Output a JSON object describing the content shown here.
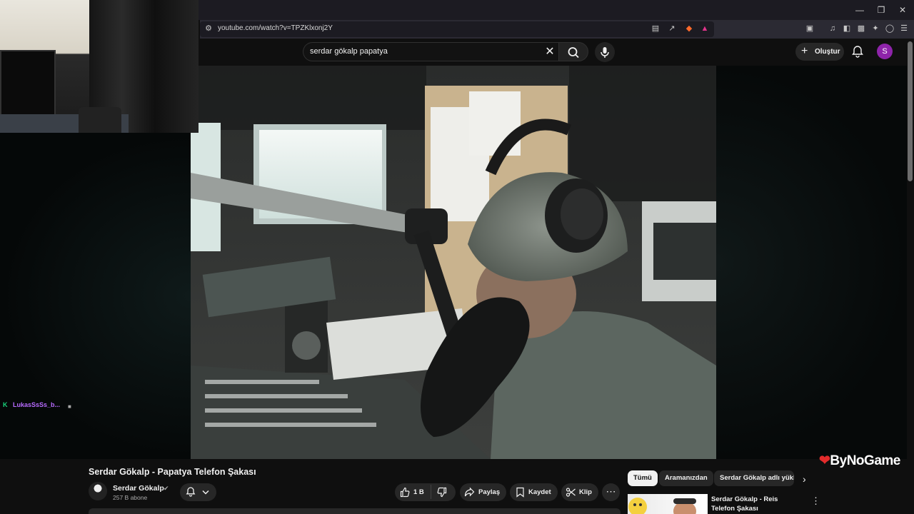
{
  "browser": {
    "url": "youtube.com/watch?v=TPZKlxonj2Y",
    "window_controls": [
      "minimize",
      "restore",
      "close"
    ]
  },
  "youtube": {
    "search": {
      "value": "serdar gökalp papatya"
    },
    "create_label": "Oluştur",
    "avatar_letter": "S"
  },
  "video": {
    "title": "Serdar Gökalp - Papatya Telefon Şakası",
    "channel": "Serdar Gökalp",
    "subscribers": "257 B abone",
    "likes": "1 B",
    "share_label": "Paylaş",
    "save_label": "Kaydet",
    "clip_label": "Klip"
  },
  "chips": [
    "Tümü",
    "Aramanızdan",
    "Serdar Gökalp adlı yükle"
  ],
  "related": {
    "title": "Serdar Gökalp - Reis Telefon Şakası"
  },
  "stream_overlay": {
    "chat_user": "LukasSsSs_b...",
    "watermark": "ByNoGame"
  },
  "colors": {
    "background": "#0f0f0f",
    "avatar": "#8e24aa",
    "chat_user": "#b86bff",
    "watermark_mark": "#e32b2b"
  }
}
